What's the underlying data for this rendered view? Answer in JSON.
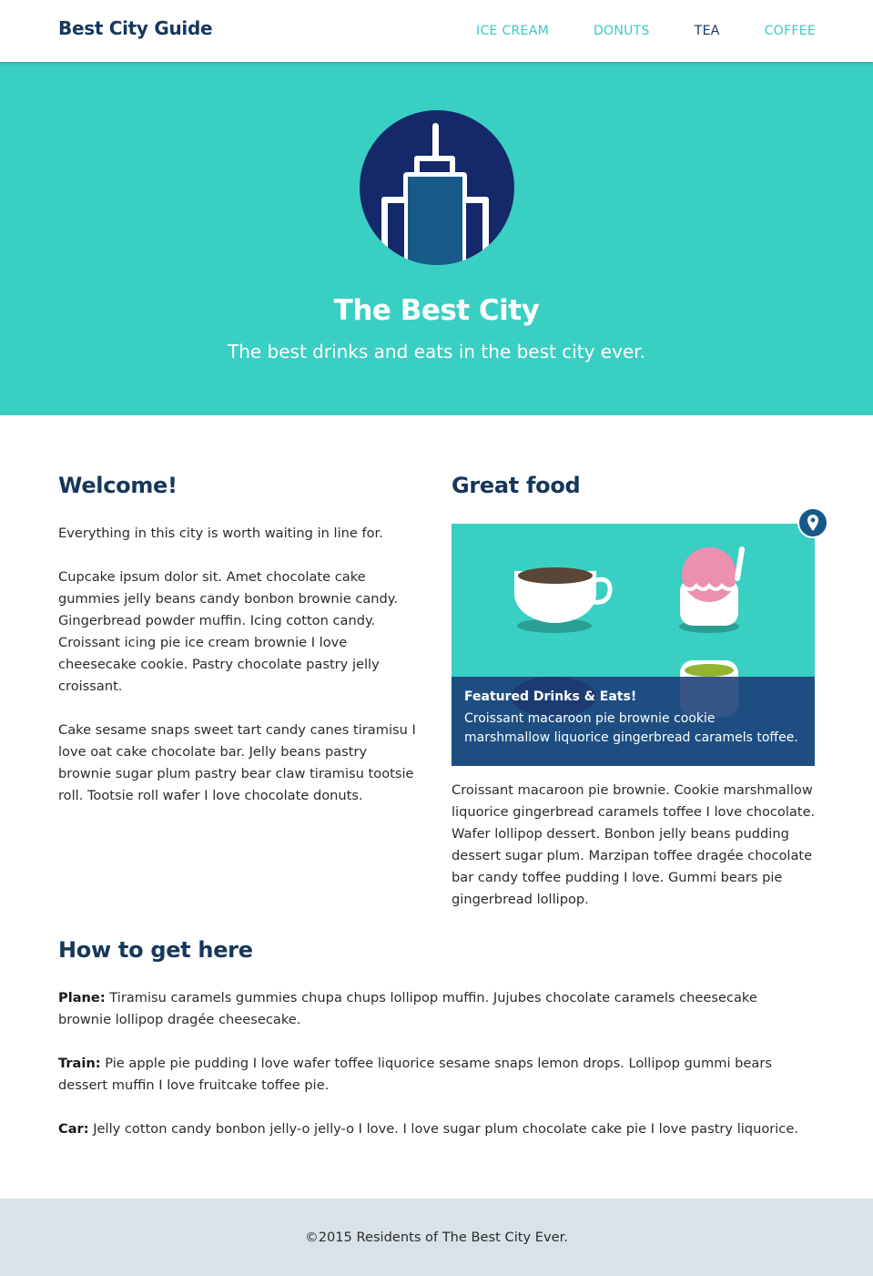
{
  "nav": {
    "brand": "Best City Guide",
    "links": [
      "ICE CREAM",
      "DONUTS",
      "TEA",
      "COFFEE"
    ],
    "active_link": "TEA"
  },
  "hero": {
    "logo_icon": "skyscraper-logo-icon",
    "title": "The Best City",
    "subtitle": "The best drinks and eats in the best city ever."
  },
  "welcome": {
    "title": "Welcome!",
    "paragraphs": [
      "Everything in this city is worth waiting in line for.",
      "Cupcake ipsum dolor sit. Amet chocolate cake gummies jelly beans candy bonbon brownie candy. Gingerbread powder muffin. Icing cotton candy. Croissant icing pie ice cream brownie I love cheesecake cookie. Pastry chocolate pastry jelly croissant.",
      "Cake sesame snaps sweet tart candy canes tiramisu I love oat cake chocolate bar. Jelly beans pastry brownie sugar plum pastry bear claw tiramisu tootsie roll. Tootsie roll wafer I love chocolate donuts."
    ]
  },
  "food": {
    "title": "Great food",
    "pin_icon": "map-pin-icon",
    "feature": {
      "caption_title": "Featured Drinks & Eats!",
      "caption_text": "Croissant macaroon pie brownie cookie marshmallow liquorice gingerbread caramels toffee."
    },
    "paragraph": "Croissant macaroon pie brownie. Cookie marshmallow liquorice gingerbread caramels toffee I love chocolate. Wafer lollipop dessert. Bonbon jelly beans pudding dessert sugar plum. Marzipan toffee dragée chocolate bar candy toffee pudding I love. Gummi bears pie gingerbread lollipop."
  },
  "directions": {
    "title": "How to get here",
    "items": [
      {
        "label": "Plane:",
        "text": " Tiramisu caramels gummies chupa chups lollipop muffin. Jujubes chocolate caramels cheesecake brownie lollipop dragée cheesecake."
      },
      {
        "label": "Train:",
        "text": " Pie apple pie pudding I love wafer toffee liquorice sesame snaps lemon drops. Lollipop gummi bears dessert muffin I love fruitcake toffee pie."
      },
      {
        "label": "Car:",
        "text": " Jelly cotton candy bonbon jelly-o jelly-o I love. I love sugar plum chocolate cake pie I love pastry liquorice."
      }
    ]
  },
  "footer": {
    "text": "©2015 Residents of The Best City Ever."
  },
  "colors": {
    "teal": "#3acfc3",
    "navy": "#16365b",
    "footer_bg": "#d8e2e8"
  }
}
